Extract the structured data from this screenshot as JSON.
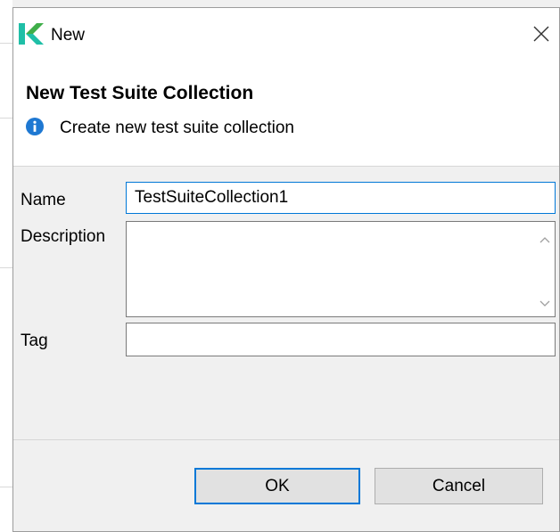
{
  "window": {
    "title": "New",
    "logo_icon": "katalon-k-logo",
    "close_icon": "close-icon"
  },
  "banner": {
    "heading": "New Test Suite Collection",
    "info_icon": "info-icon",
    "message": "Create new test suite collection"
  },
  "form": {
    "name_label": "Name",
    "name_value": "TestSuiteCollection1",
    "description_label": "Description",
    "description_value": "",
    "tag_label": "Tag",
    "tag_value": ""
  },
  "buttons": {
    "ok": "OK",
    "cancel": "Cancel"
  },
  "colors": {
    "accent": "#0078d7",
    "info": "#1e78d2",
    "logo_teal": "#1fbfa7",
    "logo_green": "#3fae49"
  }
}
